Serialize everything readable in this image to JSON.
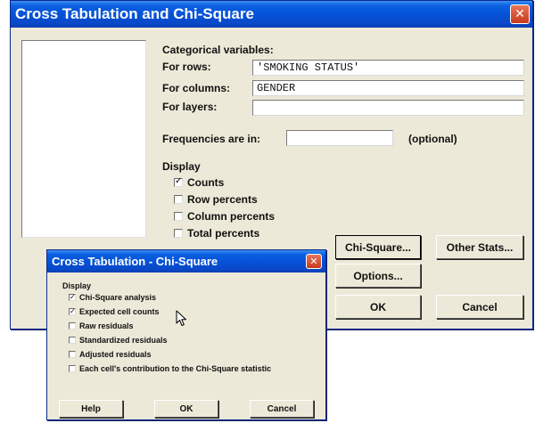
{
  "main_dialog": {
    "title": "Cross Tabulation and Chi-Square",
    "categorical_label": "Categorical variables:",
    "rows_label": "For rows:",
    "rows_value": "'SMOKING STATUS'",
    "columns_label": "For columns:",
    "columns_value": "GENDER",
    "layers_label": "For layers:",
    "layers_value": "",
    "frequencies_label": "Frequencies are in:",
    "frequencies_value": "",
    "optional_label": "(optional)",
    "display_label": "Display",
    "display_options": [
      {
        "label": "Counts",
        "checked": true
      },
      {
        "label": "Row percents",
        "checked": false
      },
      {
        "label": "Column percents",
        "checked": false
      },
      {
        "label": "Total percents",
        "checked": false
      }
    ],
    "buttons": {
      "chi_square": "Chi-Square...",
      "other_stats": "Other Stats...",
      "options": "Options...",
      "ok": "OK",
      "cancel": "Cancel"
    }
  },
  "sub_dialog": {
    "title": "Cross Tabulation - Chi-Square",
    "display_label": "Display",
    "options": [
      {
        "label": "Chi-Square analysis",
        "checked": true
      },
      {
        "label": "Expected cell counts",
        "checked": true
      },
      {
        "label": "Raw residuals",
        "checked": false
      },
      {
        "label": "Standardized residuals",
        "checked": false
      },
      {
        "label": "Adjusted residuals",
        "checked": false
      },
      {
        "label": "Each cell's contribution to the Chi-Square statistic",
        "checked": false
      }
    ],
    "buttons": {
      "help": "Help",
      "ok": "OK",
      "cancel": "Cancel"
    }
  },
  "colors": {
    "titlebar": "#0a5fe0",
    "dialog_bg": "#ece9d8",
    "close_button": "#d4532f"
  },
  "icons": {
    "close": "close-icon",
    "cursor": "mouse-pointer-icon"
  }
}
